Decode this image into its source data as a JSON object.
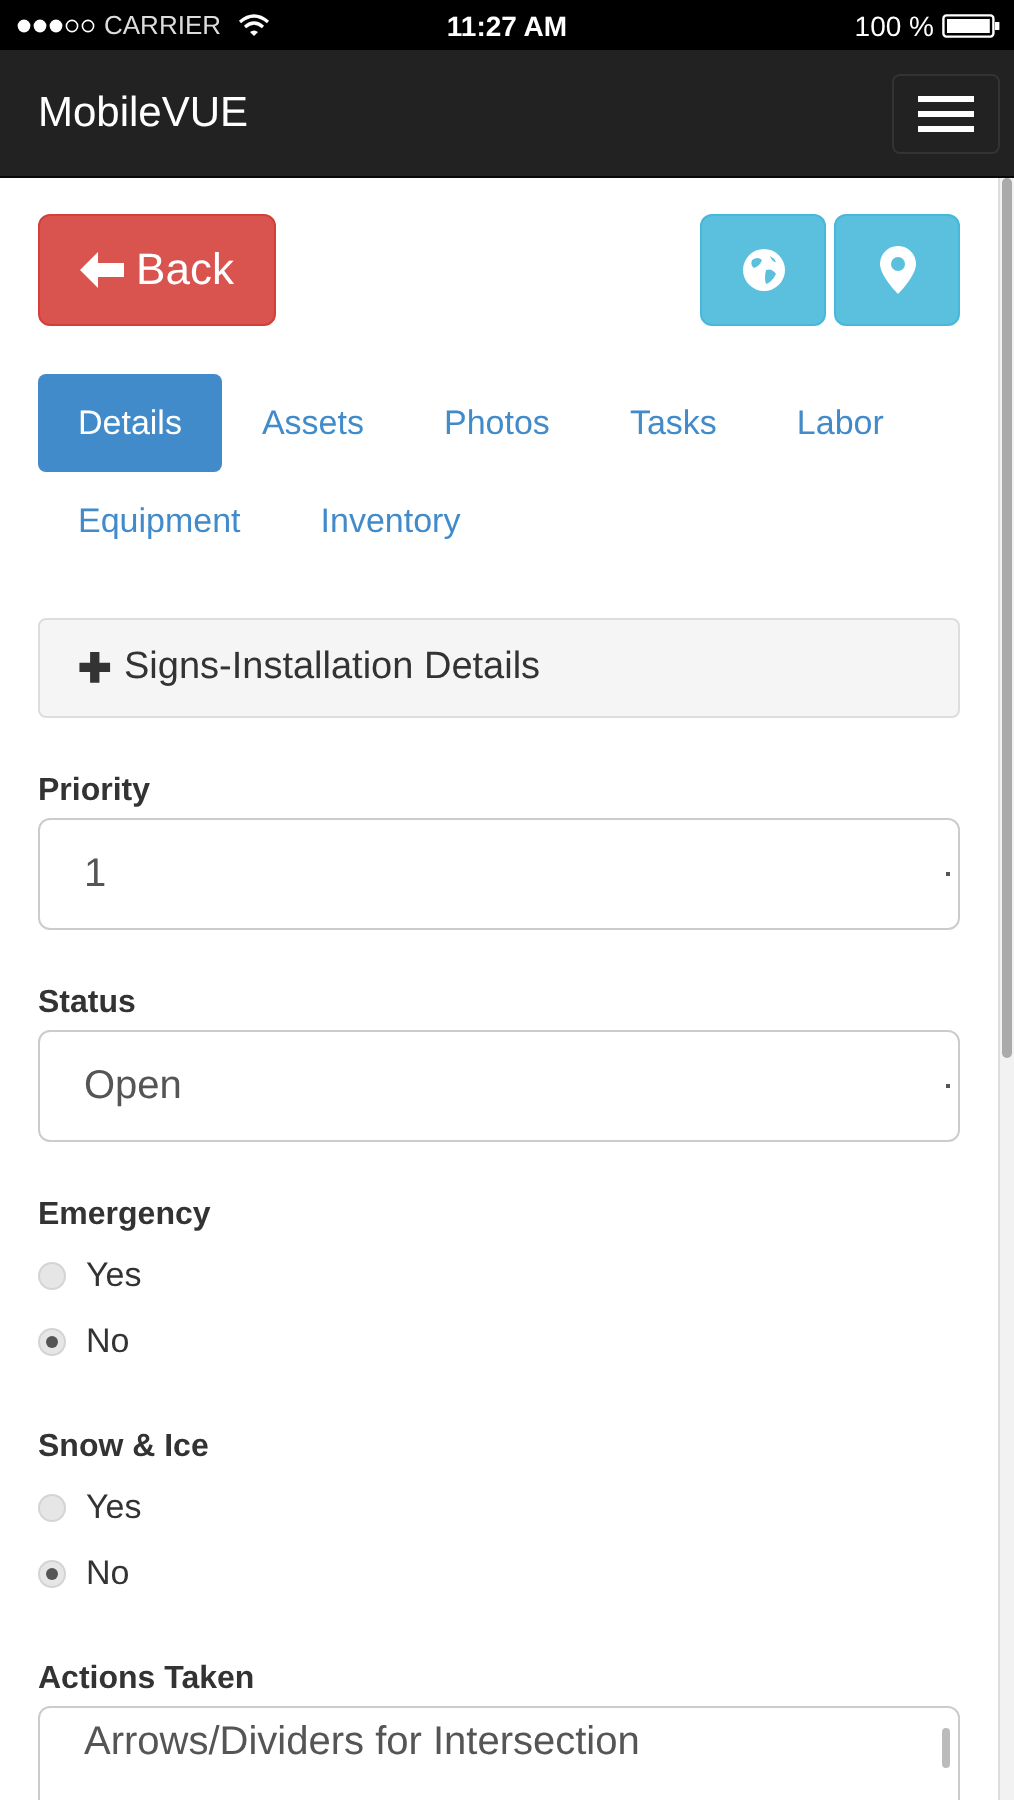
{
  "status_bar": {
    "carrier": "CARRIER",
    "time": "11:27 AM",
    "battery": "100 %"
  },
  "navbar": {
    "brand": "MobileVUE"
  },
  "back_button": {
    "label": "Back"
  },
  "tabs": [
    {
      "label": "Details",
      "selected": true
    },
    {
      "label": "Assets",
      "selected": false
    },
    {
      "label": "Photos",
      "selected": false
    },
    {
      "label": "Tasks",
      "selected": false
    },
    {
      "label": "Labor",
      "selected": false
    },
    {
      "label": "Equipment",
      "selected": false
    },
    {
      "label": "Inventory",
      "selected": false
    }
  ],
  "panel": {
    "icon": "✚",
    "title": "Signs-Installation Details",
    "expanded": false
  },
  "fields": [
    {
      "kind": "select",
      "label": "Priority",
      "value": "1"
    },
    {
      "kind": "select",
      "label": "Status",
      "value": "Open"
    },
    {
      "kind": "radio",
      "label": "Emergency",
      "options": [
        {
          "label": "Yes",
          "selected": false
        },
        {
          "label": "No",
          "selected": true
        }
      ]
    },
    {
      "kind": "radio",
      "label": "Snow & Ice",
      "options": [
        {
          "label": "Yes",
          "selected": false
        },
        {
          "label": "No",
          "selected": true
        }
      ]
    },
    {
      "kind": "list",
      "label": "Actions Taken",
      "value": "Arrows/Dividers for Intersection"
    }
  ]
}
